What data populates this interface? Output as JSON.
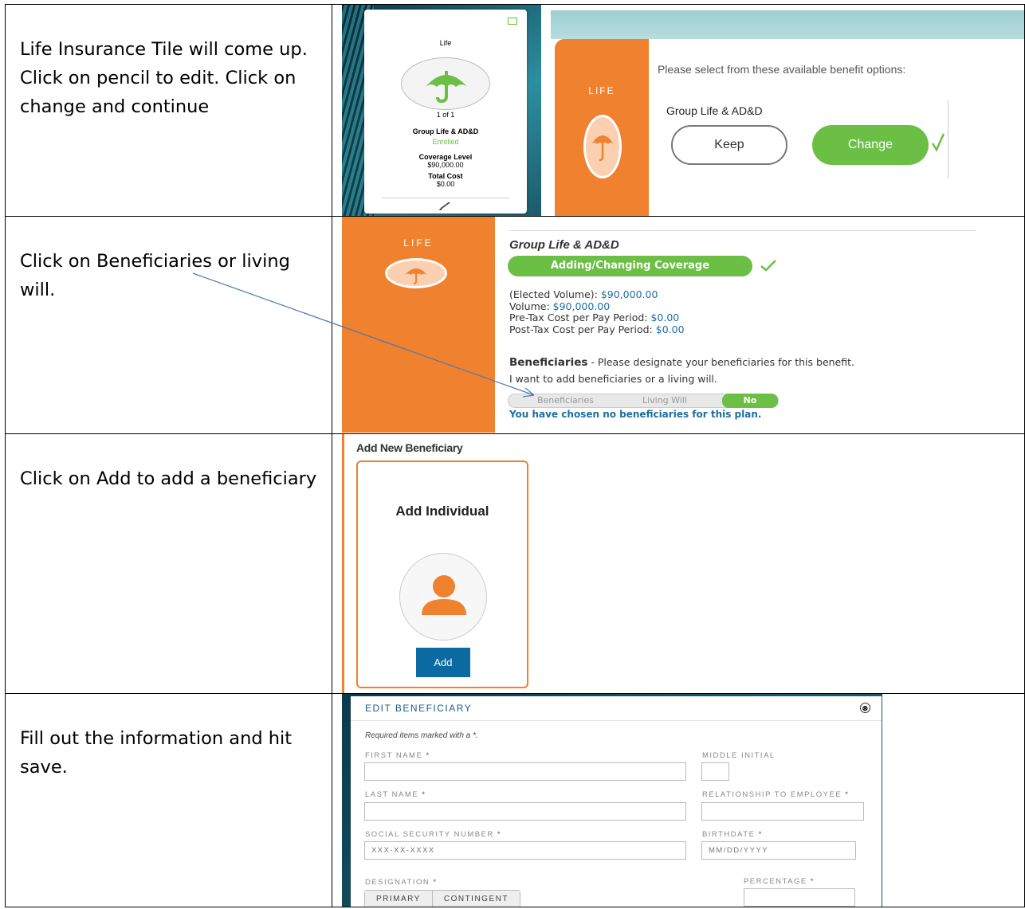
{
  "instructions": [
    "Life Insurance Tile will come up.  Click on pencil to edit.  Click on change and continue",
    "Click on Beneficiaries or living will.",
    "Click on Add to add a beneficiary",
    "Fill out the information and hit save."
  ],
  "tile": {
    "title": "Life",
    "count": "1 of 1",
    "plan": "Group Life & AD&D",
    "status": "Enrolled",
    "coverage_label": "Coverage Level",
    "coverage_value": "$90,000.00",
    "cost_label": "Total Cost",
    "cost_value": "$0.00",
    "icon": "pencil-icon"
  },
  "benefit_options": {
    "section_label": "LIFE",
    "prompt": "Please select from these available benefit options:",
    "plan": "Group Life & AD&D",
    "keep_label": "Keep",
    "change_label": "Change"
  },
  "coverage": {
    "section_label": "LIFE",
    "plan": "Group Life & AD&D",
    "status_pill": "Adding/Changing Coverage",
    "elected_label": "(Elected Volume): ",
    "elected_value": "$90,000.00",
    "volume_label": "Volume: ",
    "volume_value": "$90,000.00",
    "pretax_label": "Pre-Tax Cost per Pay Period: ",
    "pretax_value": "$0.00",
    "posttax_label": "Post-Tax Cost per Pay Period: ",
    "posttax_value": "$0.00",
    "beneficiaries_heading": "Beneficiaries",
    "beneficiaries_text": " - Please designate your beneficiaries for this benefit.",
    "beneficiaries_sub": "I want to add beneficiaries or a living will.",
    "toggle_options": [
      "Beneficiaries",
      "Living Will",
      "No"
    ],
    "none_text": "You have chosen no beneficiaries for this plan."
  },
  "add_beneficiary": {
    "title": "Add New Beneficiary",
    "card_heading": "Add Individual",
    "add_label": "Add"
  },
  "edit_beneficiary": {
    "title": "EDIT BENEFICIARY",
    "close": "⊗",
    "required_note": "Required items marked with a *.",
    "first_name_label": "FIRST NAME",
    "middle_initial_label": "MIDDLE INITIAL",
    "last_name_label": "LAST NAME",
    "relationship_label": "RELATIONSHIP TO EMPLOYEE",
    "ssn_label": "SOCIAL SECURITY NUMBER",
    "ssn_placeholder": "XXX-XX-XXXX",
    "birthdate_label": "BIRTHDATE",
    "birthdate_placeholder": "MM/DD/YYYY",
    "designation_label": "DESIGNATION",
    "percentage_label": "PERCENTAGE",
    "primary_label": "PRIMARY",
    "contingent_label": "CONTINGENT",
    "star": "*"
  },
  "colors": {
    "orange": "#f0812f",
    "green": "#6cbf45",
    "blue": "#1c6ea4",
    "button_blue": "#0a6aa1"
  }
}
